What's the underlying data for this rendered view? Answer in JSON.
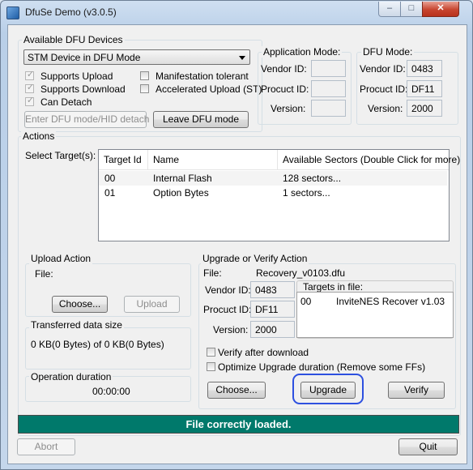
{
  "window": {
    "title": "DfuSe Demo (v3.0.5)",
    "controls": {
      "minimize": "–",
      "maximize": "□",
      "close": "✕"
    }
  },
  "devices": {
    "group_title": "Available DFU Devices",
    "selected_device": "STM Device in DFU Mode",
    "checkboxes": {
      "supports_upload": "Supports Upload",
      "supports_download": "Supports Download",
      "can_detach": "Can Detach",
      "manifestation_tolerant": "Manifestation tolerant",
      "accelerated_upload": "Accelerated Upload (ST)"
    },
    "enter_dfu_button": "Enter DFU mode/HID detach",
    "leave_dfu_button": "Leave DFU mode"
  },
  "application_mode": {
    "title": "Application Mode:",
    "vendor_label": "Vendor ID:",
    "procuct_label": "Procuct ID:",
    "version_label": "Version:",
    "vendor_value": "",
    "procuct_value": "",
    "version_value": ""
  },
  "dfu_mode": {
    "title": "DFU Mode:",
    "vendor_label": "Vendor ID:",
    "procuct_label": "Procuct ID:",
    "version_label": "Version:",
    "vendor_value": "0483",
    "procuct_value": "DF11",
    "version_value": "2000"
  },
  "actions": {
    "group_title": "Actions",
    "select_targets_label": "Select Target(s):",
    "columns": [
      "Target Id",
      "Name",
      "Available Sectors (Double Click for more)"
    ],
    "rows": [
      {
        "id": "00",
        "name": "Internal Flash",
        "sectors": "128 sectors..."
      },
      {
        "id": "01",
        "name": "Option Bytes",
        "sectors": "1 sectors..."
      }
    ]
  },
  "upload": {
    "group_title": "Upload Action",
    "file_label": "File:",
    "choose_button": "Choose...",
    "upload_button": "Upload"
  },
  "transfer": {
    "group_title": "Transferred data size",
    "value": "0 KB(0 Bytes) of 0 KB(0 Bytes)"
  },
  "duration": {
    "group_title": "Operation duration",
    "value": "00:00:00"
  },
  "upgrade": {
    "group_title": "Upgrade or Verify Action",
    "file_label": "File:",
    "file_value": "Recovery_v0103.dfu",
    "vendor_label": "Vendor ID:",
    "vendor_value": "0483",
    "procuct_label": "Procuct ID:",
    "procuct_value": "DF11",
    "version_label": "Version:",
    "version_value": "2000",
    "targets_label": "Targets in file:",
    "target_id": "00",
    "target_name": "InviteNES Recover v1.03",
    "verify_after_download": "Verify after download",
    "optimize_upgrade": "Optimize Upgrade duration (Remove some FFs)",
    "choose_button": "Choose...",
    "upgrade_button": "Upgrade",
    "verify_button": "Verify"
  },
  "status": {
    "message": "File correctly loaded.",
    "color": "#00796b"
  },
  "footer": {
    "abort_button": "Abort",
    "quit_button": "Quit"
  }
}
